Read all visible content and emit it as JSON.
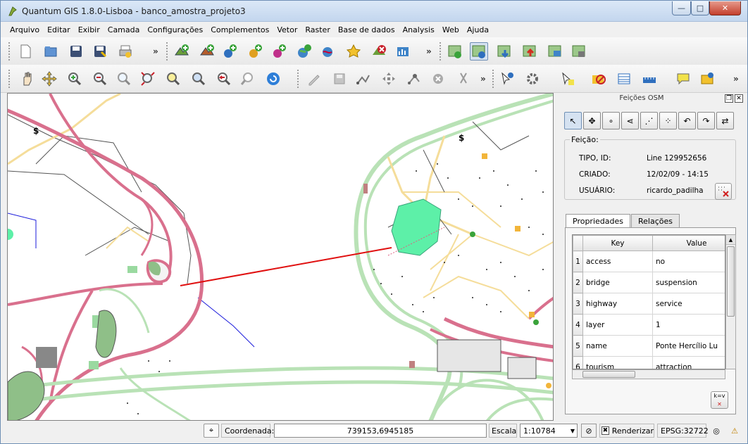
{
  "window": {
    "title": "Quantum GIS 1.8.0-Lisboa - banco_amostra_projeto3",
    "controls": {
      "minimize": "—",
      "maximize": "□",
      "close": "✕"
    }
  },
  "menu": [
    "Arquivo",
    "Editar",
    "Exibir",
    "Camada",
    "Configurações",
    "Complementos",
    "Vetor",
    "Raster",
    "Base de dados",
    "Analysis",
    "Web",
    "Ajuda"
  ],
  "toolbar1": {
    "file_tools": [
      "new-project-icon",
      "open-project-icon",
      "save-project-icon",
      "save-as-icon",
      "print-composer-icon"
    ],
    "layer_tools": [
      "add-vector-layer-icon",
      "add-raster-layer-icon",
      "add-postgis-layer-icon",
      "add-spatialite-layer-icon",
      "add-mssql-layer-icon",
      "add-wms-layer-icon",
      "add-wcs-layer-icon",
      "new-shapefile-icon",
      "remove-layer-icon",
      "add-wfs-layer-icon"
    ],
    "osm_tools": [
      "osm-load-icon",
      "osm-feature-info-icon",
      "osm-download-icon",
      "osm-upload-icon",
      "osm-import-icon",
      "osm-save-icon"
    ],
    "overflow": "»"
  },
  "toolbar2": {
    "nav_tools": [
      "pan-icon",
      "pan-to-selection-icon",
      "zoom-in-icon",
      "zoom-out-icon",
      "zoom-full-icon",
      "zoom-layer-icon",
      "zoom-selection-icon",
      "zoom-native-icon",
      "zoom-last-icon",
      "zoom-next-icon",
      "refresh-icon"
    ],
    "edit_tools": [
      "toggle-editing-icon",
      "save-edits-icon",
      "add-feature-icon",
      "move-feature-icon",
      "node-tool-icon",
      "delete-selected-icon",
      "cut-features-icon"
    ],
    "attr_tools": [
      "identify-icon",
      "action-icon",
      "select-icon",
      "deselect-icon",
      "attribute-table-icon",
      "measure-icon",
      "map-tips-icon",
      "new-bookmark-icon"
    ],
    "overflow": "»"
  },
  "osm_panel": {
    "title": "Feições OSM",
    "tools": [
      "identify-feature-icon",
      "move-icon",
      "create-point-icon",
      "create-line-icon",
      "create-polygon-icon",
      "create-relation-icon",
      "undo-icon",
      "redo-icon",
      "history-icon"
    ],
    "feature_group": "Feição:",
    "rows": [
      {
        "label": "TIPO, ID:",
        "value": "Line  129952656"
      },
      {
        "label": "CRIADO:",
        "value": "12/02/09 - 14:15"
      },
      {
        "label": "USUÁRIO:",
        "value": "ricardo_padilha"
      }
    ],
    "tabs": [
      "Propriedades",
      "Relações"
    ],
    "columns": [
      "Key",
      "Value"
    ],
    "properties": [
      {
        "n": "1",
        "key": "access",
        "value": "no"
      },
      {
        "n": "2",
        "key": "bridge",
        "value": "suspension"
      },
      {
        "n": "3",
        "key": "highway",
        "value": "service"
      },
      {
        "n": "4",
        "key": "layer",
        "value": "1"
      },
      {
        "n": "5",
        "key": "name",
        "value": "Ponte Hercílio Lu"
      },
      {
        "n": "6",
        "key": "tourism",
        "value": "attraction"
      }
    ]
  },
  "status": {
    "coord_label": "Coordenada:",
    "coord_value": "739153,6945185",
    "scale_label": "Escala",
    "scale_value": "1:10784",
    "render_label": "Renderizar",
    "epsg": "EPSG:32722"
  },
  "colors": {
    "road": "#d9708d",
    "park": "#b9e2b6",
    "highlight": "#5df0a8",
    "selected": "#e01010",
    "minor_road": "#f5dd9a"
  }
}
